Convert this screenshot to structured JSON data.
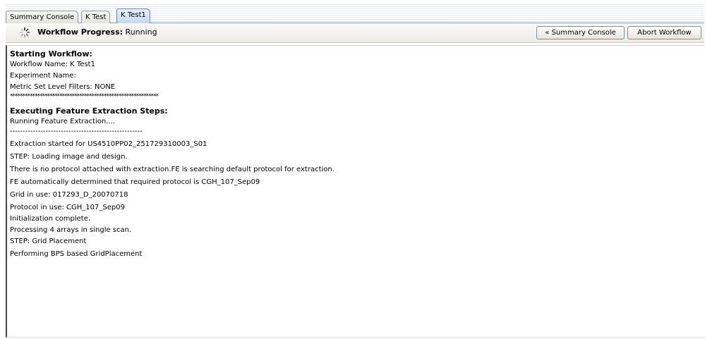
{
  "tabs": [
    {
      "label": "Summary Console",
      "active": false
    },
    {
      "label": "K Test",
      "active": false
    },
    {
      "label": "K Test1",
      "active": true
    }
  ],
  "header": {
    "icon": "spinner-icon",
    "progress_label": "Workflow Progress:",
    "progress_status": "Running",
    "summary_button": "« Summary Console",
    "abort_button": "Abort Workflow"
  },
  "log": {
    "lines": [
      {
        "text": "Starting Workflow:",
        "style": "heading"
      },
      {
        "text": "Workflow Name: K Test1",
        "style": "normal"
      },
      {
        "text": "Experiment Name:",
        "style": "normal"
      },
      {
        "text": "Metric Set Level Filters: NONE",
        "style": "normal"
      },
      {
        "text": "************************************************************",
        "style": "stars"
      },
      {
        "text": "Executing Feature Extraction Steps:",
        "style": "heading"
      },
      {
        "text": "Running Feature Extraction....",
        "style": "normal"
      },
      {
        "text": "----------------------------------------------------",
        "style": "normal"
      },
      {
        "text": "Extraction started for US4510PP02_251729310003_S01",
        "style": "normal"
      },
      {
        "text": "STEP: Loading image and design.",
        "style": "normal"
      },
      {
        "text": "There is no protocol attached with extraction.FE is searching default protocol for extraction.",
        "style": "normal"
      },
      {
        "text": "FE automatically determined that required protocol is CGH_107_Sep09",
        "style": "normal"
      },
      {
        "text": "Grid in use: 017293_D_20070718",
        "style": "normal"
      },
      {
        "text": "Protocol in use: CGH_107_Sep09",
        "style": "normal"
      },
      {
        "text": "Initialization complete.",
        "style": "normal"
      },
      {
        "text": "Processing 4 arrays in single scan.",
        "style": "normal"
      },
      {
        "text": "STEP: Grid Placement",
        "style": "normal"
      },
      {
        "text": "Performing BPS based GridPlacement",
        "style": "normal"
      }
    ]
  }
}
